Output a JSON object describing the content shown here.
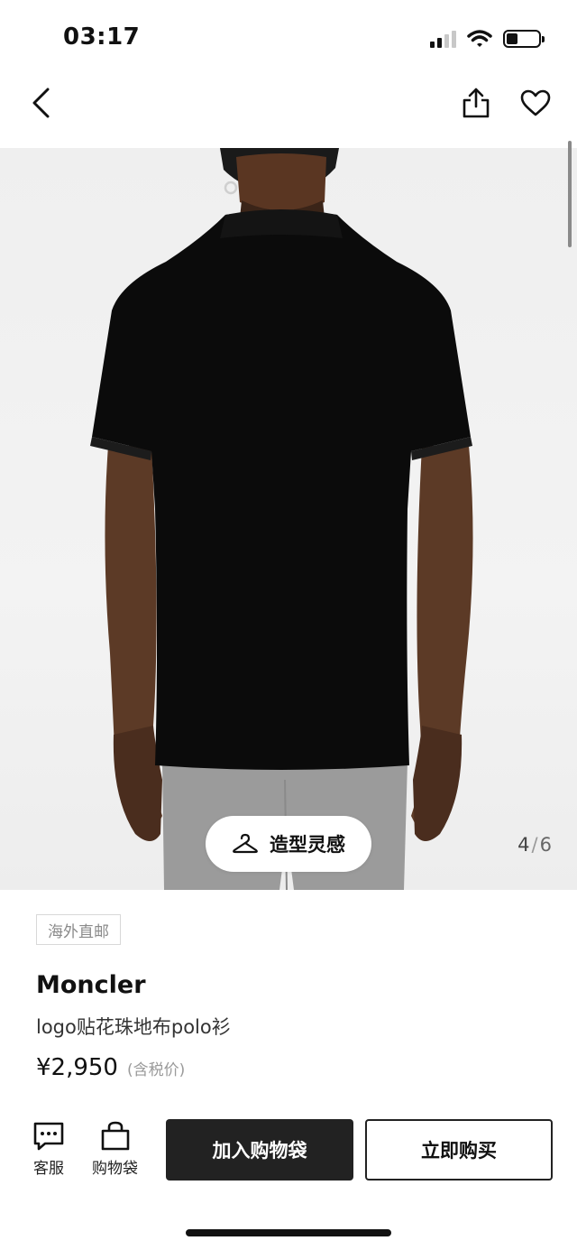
{
  "status_bar": {
    "time": "03:17",
    "battery_level": 0.35
  },
  "nav": {
    "back_icon": "chevron-left-icon",
    "share_icon": "share-icon",
    "favorite_icon": "heart-icon"
  },
  "gallery": {
    "style_button_label": "造型灵感",
    "current_page": "4",
    "separator": "/",
    "total_pages": "6"
  },
  "product": {
    "badge": "海外直邮",
    "brand": "Moncler",
    "name": "logo贴花珠地布polo衫",
    "price": "¥2,950",
    "tax_note": "(含税价)"
  },
  "actions": {
    "customer_service_label": "客服",
    "bag_label": "购物袋",
    "add_to_bag_label": "加入购物袋",
    "buy_now_label": "立即购买"
  },
  "colors": {
    "primary_button": "#222222",
    "hero_background": "#efefef",
    "shirt": "#0b0b0b",
    "trousers": "#9b9b9b"
  }
}
